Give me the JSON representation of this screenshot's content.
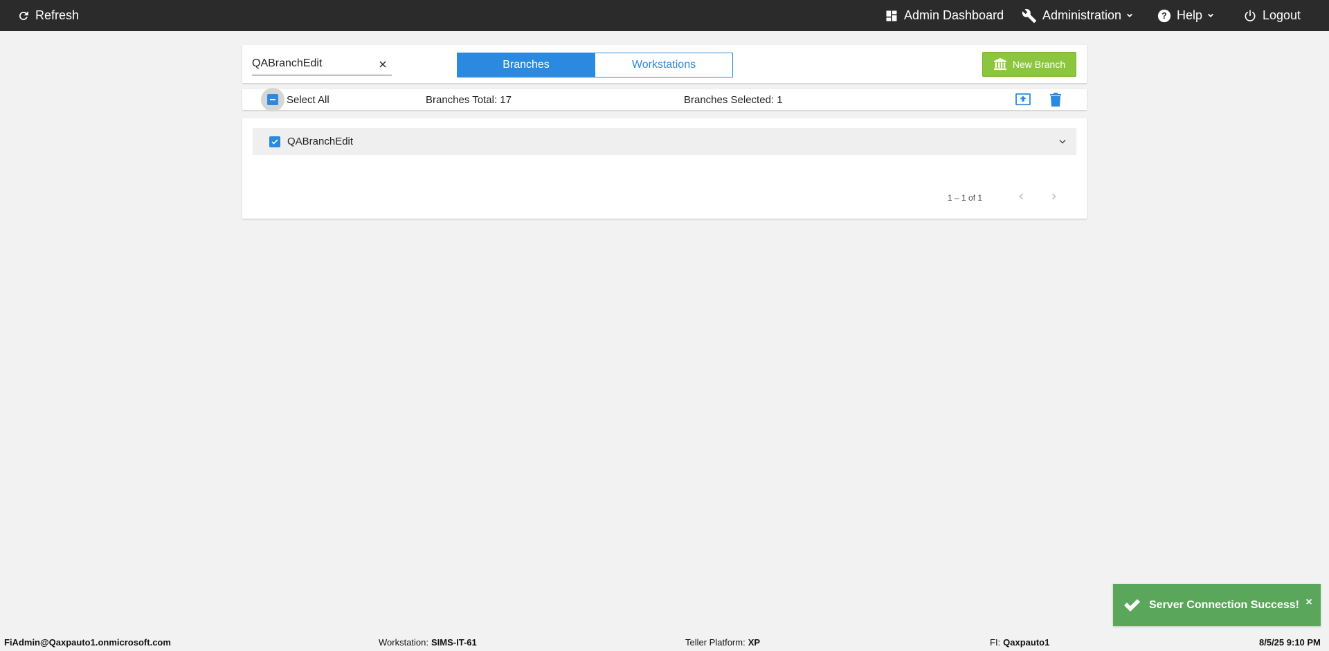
{
  "topbar": {
    "refresh_label": "Refresh",
    "admin_dashboard_label": "Admin Dashboard",
    "administration_label": "Administration",
    "help_label": "Help",
    "logout_label": "Logout"
  },
  "header": {
    "search_value": "QABranchEdit",
    "tabs": [
      {
        "label": "Branches",
        "active": true
      },
      {
        "label": "Workstations",
        "active": false
      }
    ],
    "new_branch_label": "New Branch"
  },
  "selection": {
    "select_all_label": "Select All",
    "branches_total_text": "Branches Total: 17",
    "branches_selected_text": "Branches Selected: 1"
  },
  "list": {
    "rows": [
      {
        "label": "QABranchEdit",
        "checked": true
      }
    ],
    "pager_range": "1 – 1 of 1"
  },
  "toast": {
    "message": "Server Connection Success!",
    "close_glyph": "×"
  },
  "footer": {
    "user": "FiAdmin@Qaxpauto1.onmicrosoft.com",
    "workstation_label": "Workstation:",
    "workstation_value": "SIMS-IT-61",
    "teller_platform_label": "Teller Platform:",
    "teller_platform_value": "XP",
    "fi_label": "FI:",
    "fi_value": "Qaxpauto1",
    "datetime": "8/5/25 9:10 PM"
  },
  "colors": {
    "topbar_bg": "#2b2b2b",
    "accent_blue": "#2b8ae0",
    "new_branch_green": "#8cc63f",
    "toast_green": "#5aa65a",
    "page_bg": "#f2f2f2"
  },
  "icons": {
    "refresh": "refresh-icon",
    "admin_dashboard": "dashboard-grid-icon",
    "administration": "wrench-icon",
    "help": "help-circle-icon",
    "logout": "power-icon",
    "search_clear": "close-icon",
    "new_branch": "bank-icon",
    "export": "upload-icon",
    "delete": "trash-icon",
    "expand": "chevron-down-icon",
    "toast": "checkmark-icon"
  }
}
